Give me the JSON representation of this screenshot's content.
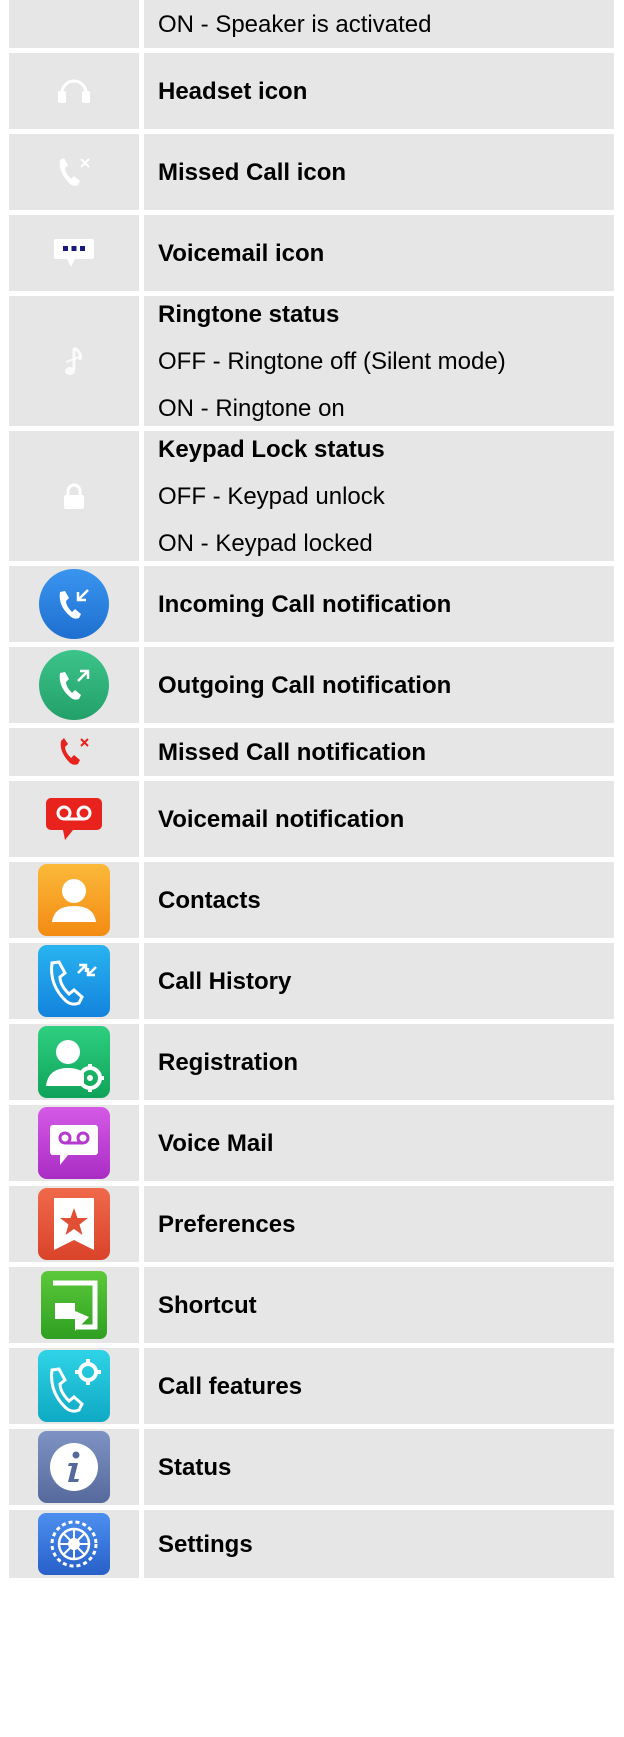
{
  "rows": [
    {
      "name": "speaker",
      "icon": "speaker-on-icon",
      "lines": [
        "ON - Speaker is activated"
      ],
      "bold_first": false
    },
    {
      "name": "headset",
      "icon": "headset-icon",
      "lines": [
        "Headset icon"
      ],
      "bold_first": true
    },
    {
      "name": "missed-call",
      "icon": "missed-call-icon",
      "lines": [
        "Missed Call icon"
      ],
      "bold_first": true
    },
    {
      "name": "voicemail",
      "icon": "voicemail-icon",
      "lines": [
        "Voicemail icon"
      ],
      "bold_first": true
    },
    {
      "name": "ringtone",
      "icon": "ringtone-icon",
      "lines": [
        "Ringtone status",
        "OFF - Ringtone off (Silent mode)",
        "ON - Ringtone on"
      ],
      "bold_first": true
    },
    {
      "name": "keypad-lock",
      "icon": "lock-icon",
      "lines": [
        "Keypad Lock status",
        "OFF - Keypad unlock",
        "ON - Keypad locked"
      ],
      "bold_first": true
    },
    {
      "name": "incoming-call-notification",
      "icon": "incoming-call-icon",
      "lines": [
        "Incoming Call notification"
      ],
      "bold_first": true
    },
    {
      "name": "outgoing-call-notification",
      "icon": "outgoing-call-icon",
      "lines": [
        "Outgoing Call notification"
      ],
      "bold_first": true
    },
    {
      "name": "missed-call-notification",
      "icon": "missed-call-red-icon",
      "lines": [
        "Missed Call notification"
      ],
      "bold_first": true
    },
    {
      "name": "voicemail-notification",
      "icon": "voicemail-red-icon",
      "lines": [
        "Voicemail notification"
      ],
      "bold_first": true
    },
    {
      "name": "contacts",
      "icon": "contacts-app-icon",
      "lines": [
        "Contacts"
      ],
      "bold_first": true
    },
    {
      "name": "call-history",
      "icon": "call-history-app-icon",
      "lines": [
        "Call History"
      ],
      "bold_first": true
    },
    {
      "name": "registration",
      "icon": "registration-app-icon",
      "lines": [
        "Registration"
      ],
      "bold_first": true
    },
    {
      "name": "voice-mail",
      "icon": "voice-mail-app-icon",
      "lines": [
        "Voice Mail"
      ],
      "bold_first": true
    },
    {
      "name": "preferences",
      "icon": "preferences-app-icon",
      "lines": [
        "Preferences"
      ],
      "bold_first": true
    },
    {
      "name": "shortcut",
      "icon": "shortcut-app-icon",
      "lines": [
        "Shortcut"
      ],
      "bold_first": true
    },
    {
      "name": "call-features",
      "icon": "call-features-app-icon",
      "lines": [
        "Call features"
      ],
      "bold_first": true
    },
    {
      "name": "status",
      "icon": "status-app-icon",
      "lines": [
        "Status"
      ],
      "bold_first": true
    },
    {
      "name": "settings",
      "icon": "settings-app-icon",
      "lines": [
        "Settings"
      ],
      "bold_first": true
    }
  ],
  "colors": {
    "cell_bg": "#e6e6e6",
    "icon_white": "#ffffff",
    "navy": "#1a1a7a",
    "alert_red": "#e8231e",
    "incoming_blue": "#2f86e6",
    "outgoing_green": "#2fb37a",
    "contacts_orange": "#f7a21b",
    "history_blue": "#1d9be8",
    "registration_green": "#19b86a",
    "voicemail_purple": "#c441d6",
    "preferences_red": "#e8553a",
    "shortcut_green": "#45b52e",
    "callfeatures_teal": "#19c0d6",
    "status_slate": "#6a7fb0",
    "settings_blue": "#3a7be0"
  }
}
